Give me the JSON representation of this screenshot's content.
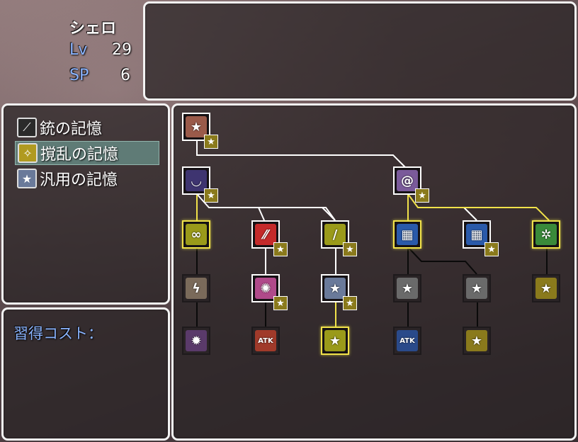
{
  "character": {
    "name": "シェロ",
    "lv_label": "Lv",
    "lv_value": "29",
    "sp_label": "SP",
    "sp_value": "6"
  },
  "categories": [
    {
      "label": "銃の記憶",
      "icon": "gun-icon",
      "selected": false
    },
    {
      "label": "撹乱の記憶",
      "icon": "disrupt-icon",
      "selected": true
    },
    {
      "label": "汎用の記憶",
      "icon": "star-icon",
      "selected": false
    }
  ],
  "cost": {
    "label": "習得コスト："
  },
  "tree": {
    "nodes": [
      {
        "id": "root",
        "icon": "star-icon",
        "color": "#9a5a4a",
        "glyph": "★",
        "learned": true,
        "state": "normal"
      },
      {
        "id": "eye",
        "icon": "closed-eye-icon",
        "color": "#3e3470",
        "glyph": "◡",
        "learned": true,
        "state": "normal"
      },
      {
        "id": "vortex",
        "icon": "vortex-icon",
        "color": "#7a5a9a",
        "glyph": "@",
        "learned": true,
        "state": "normal"
      },
      {
        "id": "bubbles",
        "icon": "bubbles-icon",
        "color": "#9a9a1a",
        "glyph": "∞",
        "learned": false,
        "state": "highlight"
      },
      {
        "id": "slash",
        "icon": "slash-icon",
        "color": "#c42a2a",
        "glyph": "⁄⁄",
        "learned": true,
        "state": "normal"
      },
      {
        "id": "sword",
        "icon": "sword-icon",
        "color": "#9a9a1a",
        "glyph": "/",
        "learned": true,
        "state": "normal"
      },
      {
        "id": "armor",
        "icon": "armor-icon",
        "color": "#2a5aaa",
        "glyph": "▦",
        "learned": false,
        "state": "highlight"
      },
      {
        "id": "armor2",
        "icon": "armor-icon",
        "color": "#2a5aaa",
        "glyph": "▦",
        "learned": true,
        "state": "normal"
      },
      {
        "id": "gear",
        "icon": "gear-icon",
        "color": "#3a8a3a",
        "glyph": "✲",
        "learned": false,
        "state": "highlight"
      },
      {
        "id": "lightning",
        "icon": "lightning-icon",
        "color": "#7a6a5a",
        "glyph": "ϟ",
        "learned": false,
        "state": "dim"
      },
      {
        "id": "burst",
        "icon": "burst-icon",
        "color": "#b04a8a",
        "glyph": "✺",
        "learned": true,
        "state": "normal"
      },
      {
        "id": "star-silver",
        "icon": "star-icon",
        "color": "#6a7a9a",
        "glyph": "★",
        "learned": true,
        "state": "normal"
      },
      {
        "id": "star-gray-1",
        "icon": "star-icon",
        "color": "#6a6a6a",
        "glyph": "★",
        "learned": false,
        "state": "dim"
      },
      {
        "id": "star-gray-2",
        "icon": "star-icon",
        "color": "#6a6a6a",
        "glyph": "★",
        "learned": false,
        "state": "dim"
      },
      {
        "id": "star-gold-1",
        "icon": "star-icon",
        "color": "#8a7a1c",
        "glyph": "★",
        "learned": false,
        "state": "dim"
      },
      {
        "id": "spider",
        "icon": "spider-icon",
        "color": "#5a3a6a",
        "glyph": "✹",
        "learned": false,
        "state": "dim"
      },
      {
        "id": "atk-up",
        "icon": "atk-up-icon",
        "color": "#a03a2a",
        "glyph": "ATK",
        "learned": false,
        "state": "dim"
      },
      {
        "id": "star-gold-2",
        "icon": "star-icon",
        "color": "#9a9a1a",
        "glyph": "★",
        "learned": false,
        "state": "highlight"
      },
      {
        "id": "atk-down",
        "icon": "atk-down-icon",
        "color": "#2a4a8a",
        "glyph": "ATK",
        "learned": false,
        "state": "dim"
      },
      {
        "id": "star-gold-3",
        "icon": "star-icon",
        "color": "#8a7a1c",
        "glyph": "★",
        "learned": false,
        "state": "dim"
      }
    ]
  }
}
